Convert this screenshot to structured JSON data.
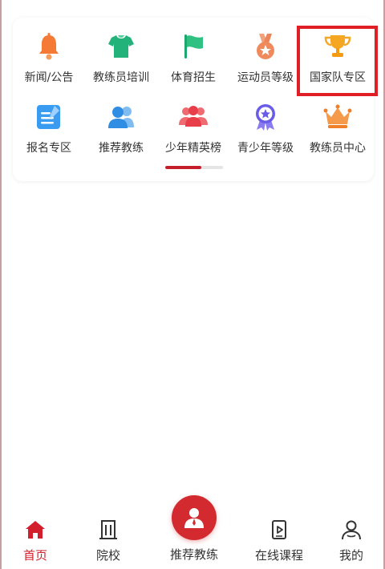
{
  "menu": {
    "items": [
      {
        "label": "新闻/公告",
        "icon": "bell-icon"
      },
      {
        "label": "教练员培训",
        "icon": "shirt-icon"
      },
      {
        "label": "体育招生",
        "icon": "flag-icon"
      },
      {
        "label": "运动员等级",
        "icon": "medal-icon"
      },
      {
        "label": "国家队专区",
        "icon": "trophy-icon"
      },
      {
        "label": "报名专区",
        "icon": "form-edit-icon"
      },
      {
        "label": "推荐教练",
        "icon": "people-icon"
      },
      {
        "label": "少年精英榜",
        "icon": "group-icon"
      },
      {
        "label": "青少年等级",
        "icon": "star-badge-icon"
      },
      {
        "label": "教练员中心",
        "icon": "crown-icon"
      }
    ],
    "pager_progress": 0.62
  },
  "tabbar": {
    "items": [
      {
        "label": "首页",
        "icon": "home-icon",
        "active": true
      },
      {
        "label": "院校",
        "icon": "building-icon",
        "active": false
      },
      {
        "label": "推荐教练",
        "icon": "coach-icon",
        "active": false
      },
      {
        "label": "在线课程",
        "icon": "video-icon",
        "active": false
      },
      {
        "label": "我的",
        "icon": "user-icon",
        "active": false
      }
    ]
  },
  "colors": {
    "accent": "#d21f2b",
    "highlight_box": "#e01e26"
  }
}
